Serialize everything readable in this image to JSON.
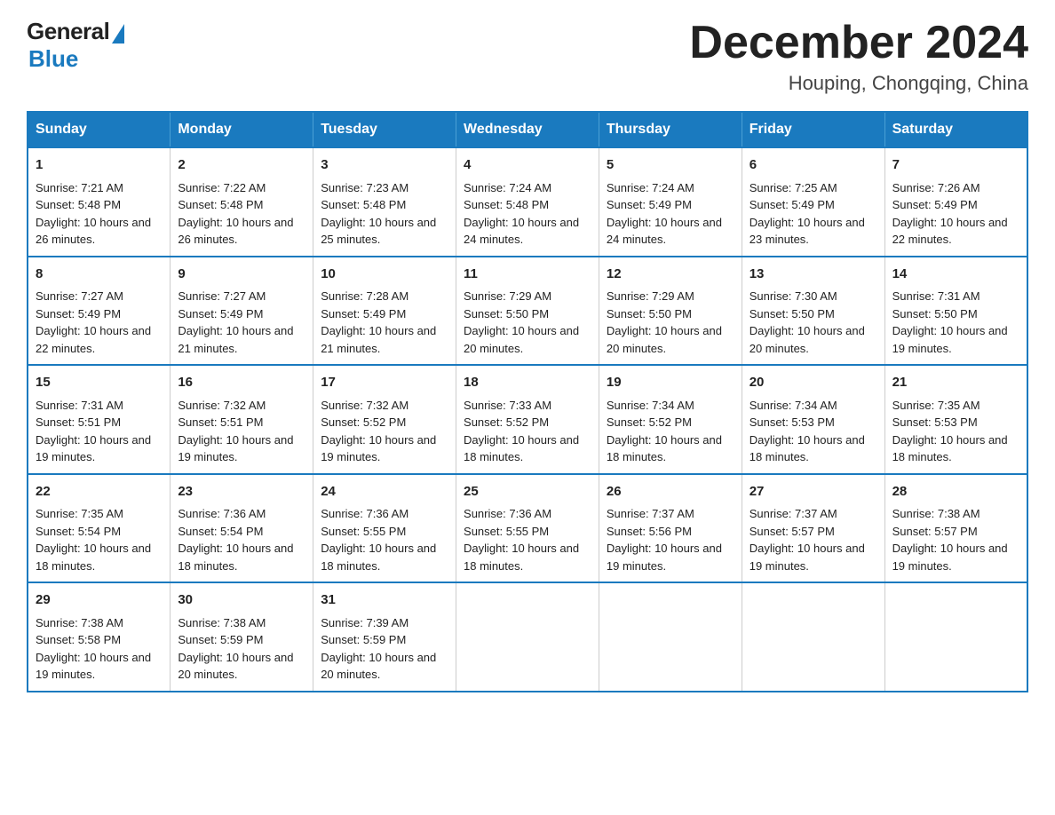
{
  "logo": {
    "general": "General",
    "blue": "Blue",
    "tagline": "Blue"
  },
  "title": "December 2024",
  "location": "Houping, Chongqing, China",
  "days_of_week": [
    "Sunday",
    "Monday",
    "Tuesday",
    "Wednesday",
    "Thursday",
    "Friday",
    "Saturday"
  ],
  "weeks": [
    [
      {
        "day": "1",
        "sunrise": "7:21 AM",
        "sunset": "5:48 PM",
        "daylight": "10 hours and 26 minutes."
      },
      {
        "day": "2",
        "sunrise": "7:22 AM",
        "sunset": "5:48 PM",
        "daylight": "10 hours and 26 minutes."
      },
      {
        "day": "3",
        "sunrise": "7:23 AM",
        "sunset": "5:48 PM",
        "daylight": "10 hours and 25 minutes."
      },
      {
        "day": "4",
        "sunrise": "7:24 AM",
        "sunset": "5:48 PM",
        "daylight": "10 hours and 24 minutes."
      },
      {
        "day": "5",
        "sunrise": "7:24 AM",
        "sunset": "5:49 PM",
        "daylight": "10 hours and 24 minutes."
      },
      {
        "day": "6",
        "sunrise": "7:25 AM",
        "sunset": "5:49 PM",
        "daylight": "10 hours and 23 minutes."
      },
      {
        "day": "7",
        "sunrise": "7:26 AM",
        "sunset": "5:49 PM",
        "daylight": "10 hours and 22 minutes."
      }
    ],
    [
      {
        "day": "8",
        "sunrise": "7:27 AM",
        "sunset": "5:49 PM",
        "daylight": "10 hours and 22 minutes."
      },
      {
        "day": "9",
        "sunrise": "7:27 AM",
        "sunset": "5:49 PM",
        "daylight": "10 hours and 21 minutes."
      },
      {
        "day": "10",
        "sunrise": "7:28 AM",
        "sunset": "5:49 PM",
        "daylight": "10 hours and 21 minutes."
      },
      {
        "day": "11",
        "sunrise": "7:29 AM",
        "sunset": "5:50 PM",
        "daylight": "10 hours and 20 minutes."
      },
      {
        "day": "12",
        "sunrise": "7:29 AM",
        "sunset": "5:50 PM",
        "daylight": "10 hours and 20 minutes."
      },
      {
        "day": "13",
        "sunrise": "7:30 AM",
        "sunset": "5:50 PM",
        "daylight": "10 hours and 20 minutes."
      },
      {
        "day": "14",
        "sunrise": "7:31 AM",
        "sunset": "5:50 PM",
        "daylight": "10 hours and 19 minutes."
      }
    ],
    [
      {
        "day": "15",
        "sunrise": "7:31 AM",
        "sunset": "5:51 PM",
        "daylight": "10 hours and 19 minutes."
      },
      {
        "day": "16",
        "sunrise": "7:32 AM",
        "sunset": "5:51 PM",
        "daylight": "10 hours and 19 minutes."
      },
      {
        "day": "17",
        "sunrise": "7:32 AM",
        "sunset": "5:52 PM",
        "daylight": "10 hours and 19 minutes."
      },
      {
        "day": "18",
        "sunrise": "7:33 AM",
        "sunset": "5:52 PM",
        "daylight": "10 hours and 18 minutes."
      },
      {
        "day": "19",
        "sunrise": "7:34 AM",
        "sunset": "5:52 PM",
        "daylight": "10 hours and 18 minutes."
      },
      {
        "day": "20",
        "sunrise": "7:34 AM",
        "sunset": "5:53 PM",
        "daylight": "10 hours and 18 minutes."
      },
      {
        "day": "21",
        "sunrise": "7:35 AM",
        "sunset": "5:53 PM",
        "daylight": "10 hours and 18 minutes."
      }
    ],
    [
      {
        "day": "22",
        "sunrise": "7:35 AM",
        "sunset": "5:54 PM",
        "daylight": "10 hours and 18 minutes."
      },
      {
        "day": "23",
        "sunrise": "7:36 AM",
        "sunset": "5:54 PM",
        "daylight": "10 hours and 18 minutes."
      },
      {
        "day": "24",
        "sunrise": "7:36 AM",
        "sunset": "5:55 PM",
        "daylight": "10 hours and 18 minutes."
      },
      {
        "day": "25",
        "sunrise": "7:36 AM",
        "sunset": "5:55 PM",
        "daylight": "10 hours and 18 minutes."
      },
      {
        "day": "26",
        "sunrise": "7:37 AM",
        "sunset": "5:56 PM",
        "daylight": "10 hours and 19 minutes."
      },
      {
        "day": "27",
        "sunrise": "7:37 AM",
        "sunset": "5:57 PM",
        "daylight": "10 hours and 19 minutes."
      },
      {
        "day": "28",
        "sunrise": "7:38 AM",
        "sunset": "5:57 PM",
        "daylight": "10 hours and 19 minutes."
      }
    ],
    [
      {
        "day": "29",
        "sunrise": "7:38 AM",
        "sunset": "5:58 PM",
        "daylight": "10 hours and 19 minutes."
      },
      {
        "day": "30",
        "sunrise": "7:38 AM",
        "sunset": "5:59 PM",
        "daylight": "10 hours and 20 minutes."
      },
      {
        "day": "31",
        "sunrise": "7:39 AM",
        "sunset": "5:59 PM",
        "daylight": "10 hours and 20 minutes."
      },
      {
        "day": "",
        "sunrise": "",
        "sunset": "",
        "daylight": ""
      },
      {
        "day": "",
        "sunrise": "",
        "sunset": "",
        "daylight": ""
      },
      {
        "day": "",
        "sunrise": "",
        "sunset": "",
        "daylight": ""
      },
      {
        "day": "",
        "sunrise": "",
        "sunset": "",
        "daylight": ""
      }
    ]
  ]
}
